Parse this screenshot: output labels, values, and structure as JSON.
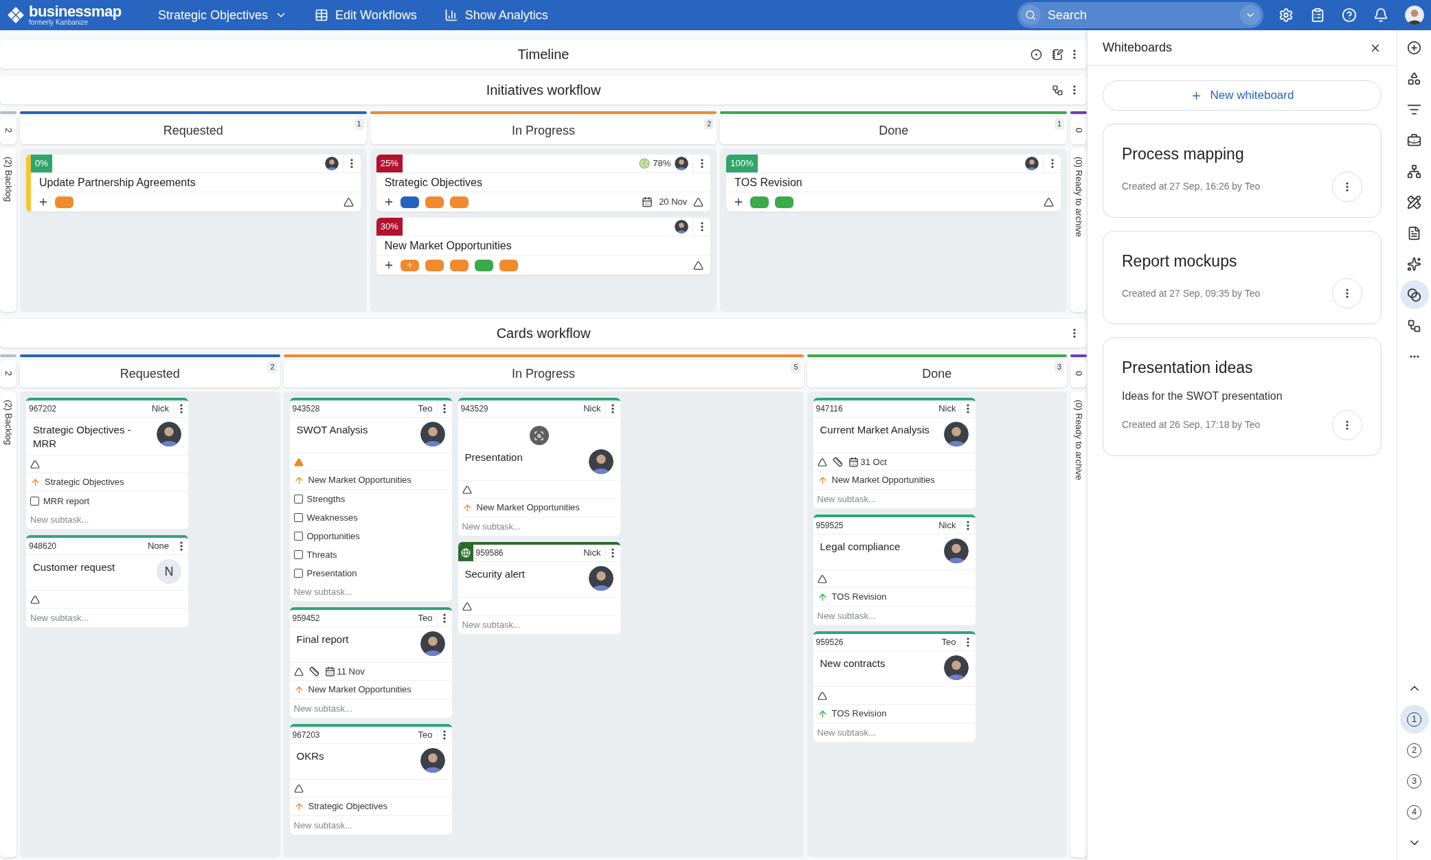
{
  "topbar": {
    "logo": {
      "name": "businessmap",
      "tagline": "formerly Kanbanize"
    },
    "nav": [
      {
        "kind": "dropdown",
        "label": "Strategic Objectives"
      },
      {
        "kind": "workflows",
        "label": "Edit Workflows"
      },
      {
        "kind": "analytics",
        "label": "Show Analytics"
      }
    ],
    "search": {
      "placeholder": "Search"
    }
  },
  "timeline": {
    "title": "Timeline"
  },
  "boards": [
    {
      "kind": "initiatives",
      "title": "Initiatives workflow",
      "backlog": {
        "count": "2",
        "label": "(2) Backlog"
      },
      "archive": {
        "count": "0",
        "label": "(0) Ready to archive"
      },
      "columns": [
        {
          "title": "Requested",
          "count": "1",
          "color": "#2563c0",
          "lanes": [
            [
              {
                "progress": {
                  "text": "0%",
                  "color": "#2ea66b"
                },
                "stripe": {
                  "color": "#f7c630"
                },
                "title": "Update Partnership Agreements",
                "avatar": {
                  "kind": "photo"
                },
                "tags": [
                  {
                    "kind": "plain",
                    "color": "#f08a2c"
                  }
                ]
              }
            ]
          ]
        },
        {
          "title": "In Progress",
          "count": "2",
          "color": "#f08a2c",
          "lanes": [
            [
              {
                "progress": {
                  "text": "25%",
                  "color": "#b3112e"
                },
                "target": "78%",
                "title": "Strategic Objectives",
                "avatar": {
                  "kind": "photo"
                },
                "tags": [
                  {
                    "kind": "plain",
                    "color": "#2563c0"
                  },
                  {
                    "kind": "plain",
                    "color": "#f08a2c"
                  },
                  {
                    "kind": "plain",
                    "color": "#f08a2c"
                  }
                ],
                "date": "20 Nov"
              },
              {
                "progress": {
                  "text": "30%",
                  "color": "#b3112e"
                },
                "title": "New Market Opportunities",
                "avatar": {
                  "kind": "photo"
                },
                "tags": [
                  {
                    "kind": "parent",
                    "color": "#f08a2c"
                  },
                  {
                    "kind": "plain",
                    "color": "#f08a2c"
                  },
                  {
                    "kind": "plain",
                    "color": "#f08a2c"
                  },
                  {
                    "kind": "plain",
                    "color": "#3aaa4a"
                  },
                  {
                    "kind": "plain",
                    "color": "#f08a2c"
                  }
                ]
              }
            ]
          ]
        },
        {
          "title": "Done",
          "count": "1",
          "color": "#3aaa4a",
          "lanes": [
            [
              {
                "progress": {
                  "text": "100%",
                  "color": "#2ea66b"
                },
                "title": "TOS Revision",
                "avatar": {
                  "kind": "photo"
                },
                "tags": [
                  {
                    "kind": "plain",
                    "color": "#3aaa4a"
                  },
                  {
                    "kind": "plain",
                    "color": "#3aaa4a"
                  }
                ]
              }
            ]
          ]
        }
      ]
    },
    {
      "kind": "cards",
      "title": "Cards workflow",
      "backlog": {
        "count": "2",
        "label": "(2) Backlog"
      },
      "archive": {
        "count": "0",
        "label": "(0) Ready to archive"
      },
      "columns": [
        {
          "title": "Requested",
          "count": "2",
          "color": "#2563c0",
          "lanes": [
            [
              {
                "kind": "standard",
                "color": "#2ea67a",
                "id": "967202",
                "owner": "Nick",
                "title": "Strategic Objectives - MRR",
                "avatar": {
                  "kind": "photo"
                },
                "meta": {
                  "high_priority": false,
                  "sized": false
                },
                "parent": {
                  "text": "Strategic Objectives",
                  "color": "#f08a2c"
                },
                "subtasks": [
                  {
                    "label": "MRR report",
                    "checked": false
                  }
                ],
                "new_subtask": {
                  "placeholder": "New subtask..."
                }
              },
              {
                "kind": "standard",
                "color": "#2ea67a",
                "id": "948620",
                "owner": "None",
                "title": "Customer request",
                "avatar": {
                  "kind": "initial",
                  "text": "N"
                },
                "meta": {
                  "high_priority": false,
                  "sized": false
                },
                "new_subtask": {
                  "placeholder": "New subtask..."
                }
              }
            ]
          ]
        },
        {
          "title": "In Progress",
          "count": "5",
          "color": "#f08a2c",
          "lanes": [
            [
              {
                "kind": "standard",
                "color": "#2ea67a",
                "id": "943528",
                "owner": "Teo",
                "title": "SWOT Analysis",
                "avatar": {
                  "kind": "photo"
                },
                "meta": {
                  "high_priority": true,
                  "sized": false
                },
                "parent": {
                  "text": "New Market Opportunities",
                  "color": "#f08a2c"
                },
                "subtasks": [
                  {
                    "label": "Strengths",
                    "checked": false
                  },
                  {
                    "label": "Weaknesses",
                    "checked": false
                  },
                  {
                    "label": "Opportunities",
                    "checked": false
                  },
                  {
                    "label": "Threats",
                    "checked": false
                  },
                  {
                    "label": "Presentation",
                    "checked": false
                  }
                ],
                "new_subtask": {
                  "placeholder": "New subtask..."
                }
              },
              {
                "kind": "standard",
                "color": "#2ea67a",
                "id": "959452",
                "owner": "Teo",
                "title": "Final report",
                "avatar": {
                  "kind": "photo"
                },
                "meta": {
                  "high_priority": false,
                  "sized": true,
                  "date": "11 Nov"
                },
                "parent": {
                  "text": "New Market Opportunities",
                  "color": "#f08a2c"
                },
                "new_subtask": {
                  "placeholder": "New subtask..."
                }
              },
              {
                "kind": "standard",
                "color": "#2ea67a",
                "id": "967203",
                "owner": "Teo",
                "title": "OKRs",
                "avatar": {
                  "kind": "photo"
                },
                "meta": {
                  "high_priority": false,
                  "sized": false
                },
                "parent": {
                  "text": "Strategic Objectives",
                  "color": "#f08a2c"
                },
                "new_subtask": {
                  "placeholder": "New subtask..."
                }
              }
            ],
            [
              {
                "kind": "cover",
                "color": "#2ea67a",
                "id": "943529",
                "owner": "Nick",
                "title": "Presentation",
                "avatar": {
                  "kind": "photo"
                },
                "meta": {
                  "high_priority": false,
                  "sized": false
                },
                "parent": {
                  "text": "New Market Opportunities",
                  "color": "#f08a2c"
                },
                "new_subtask": {
                  "placeholder": "New subtask..."
                }
              },
              {
                "kind": "alert",
                "color": "#2d6a2f",
                "id": "959586",
                "owner": "Nick",
                "title": "Security alert",
                "avatar": {
                  "kind": "photo"
                },
                "meta": {
                  "high_priority": false,
                  "sized": false
                },
                "new_subtask": {
                  "placeholder": "New subtask..."
                }
              }
            ]
          ]
        },
        {
          "title": "Done",
          "count": "3",
          "color": "#3aaa4a",
          "lanes": [
            [
              {
                "kind": "standard",
                "color": "#2ea67a",
                "id": "947116",
                "owner": "Nick",
                "title": "Current Market Analysis",
                "avatar": {
                  "kind": "photo"
                },
                "meta": {
                  "high_priority": false,
                  "sized": true,
                  "date": "31 Oct"
                },
                "parent": {
                  "text": "New Market Opportunities",
                  "color": "#f08a2c"
                },
                "new_subtask": {
                  "placeholder": "New subtask..."
                }
              },
              {
                "kind": "standard",
                "color": "#2ea67a",
                "id": "959525",
                "owner": "Nick",
                "title": "Legal compliance",
                "avatar": {
                  "kind": "photo"
                },
                "meta": {
                  "high_priority": false,
                  "sized": false
                },
                "parent": {
                  "text": "TOS Revision",
                  "color": "#3aaa4a"
                },
                "new_subtask": {
                  "placeholder": "New subtask..."
                }
              },
              {
                "kind": "standard",
                "color": "#2ea67a",
                "id": "959526",
                "owner": "Teo",
                "title": "New contracts",
                "avatar": {
                  "kind": "photo"
                },
                "meta": {
                  "high_priority": false,
                  "sized": false
                },
                "parent": {
                  "text": "TOS Revision",
                  "color": "#3aaa4a"
                },
                "new_subtask": {
                  "placeholder": "New subtask..."
                }
              }
            ]
          ]
        }
      ]
    }
  ],
  "whiteboards": {
    "title": "Whiteboards",
    "new_label": "New whiteboard",
    "items": [
      {
        "title": "Process mapping",
        "created": "Created at 27 Sep, 16:26 by Teo"
      },
      {
        "title": "Report mockups",
        "created": "Created at 27 Sep, 09:35 by Teo"
      },
      {
        "title": "Presentation ideas",
        "description": "Ideas for the SWOT presentation",
        "created": "Created at 26 Sep, 17:18 by Teo"
      }
    ]
  },
  "rail": {
    "tools": [
      {
        "kind": "add",
        "selected": false
      },
      {
        "kind": "shapes",
        "selected": false
      },
      {
        "kind": "filter",
        "selected": false
      },
      {
        "kind": "briefcase",
        "selected": false
      },
      {
        "kind": "hierarchy",
        "selected": false
      },
      {
        "kind": "tools",
        "selected": false
      },
      {
        "kind": "document",
        "selected": false
      },
      {
        "kind": "sparkles",
        "selected": false
      },
      {
        "kind": "whiteboard",
        "selected": true
      },
      {
        "kind": "workflow",
        "selected": false
      },
      {
        "kind": "more",
        "selected": false
      }
    ],
    "pages": [
      {
        "label": "1",
        "selected": true
      },
      {
        "label": "2",
        "selected": false
      },
      {
        "label": "3",
        "selected": false
      },
      {
        "label": "4",
        "selected": false
      }
    ]
  }
}
